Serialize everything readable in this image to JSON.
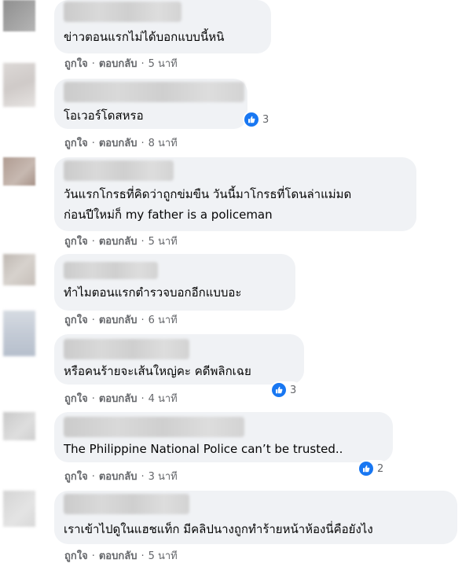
{
  "colors": {
    "bubble": "#f0f2f5",
    "text": "#050505",
    "meta": "#65676b",
    "like": "#1877f2"
  },
  "actions": {
    "like_label": "ถูกใจ",
    "reply_label": "ตอบกลับ",
    "separator": "·"
  },
  "comments": [
    {
      "lines": [
        "ข่าวตอนแรกไม่ได้บอกแบบนี้หนิ"
      ],
      "time": "5 นาที",
      "reaction_count": null
    },
    {
      "lines": [
        "โอเวอร์โดสหรอ"
      ],
      "time": "8 นาที",
      "reaction_icon": "like-icon",
      "reaction_count": "3"
    },
    {
      "lines": [
        "วันแรกโกรธที่คิดว่าถูกข่มขืน วันนี้มาโกรธที่โดนล่าแม่มด",
        "ก่อนปีใหม่ก็ my father is a policeman"
      ],
      "time": "5 นาที",
      "reaction_count": null
    },
    {
      "lines": [
        "ทำไมตอนแรกตำรวจบอกอีกแบบอะ"
      ],
      "time": "6 นาที",
      "reaction_count": null
    },
    {
      "lines": [
        "หรือคนร้ายจะเส้นใหญ่คะ คดีพลิกเฉย"
      ],
      "time": "4 นาที",
      "reaction_icon": "like-icon",
      "reaction_count": "3"
    },
    {
      "lines": [
        "The Philippine National Police can’t be trusted.."
      ],
      "time": "3 นาที",
      "reaction_icon": "like-icon",
      "reaction_count": "2"
    },
    {
      "lines": [
        "เราเข้าไปดูในแฮชแท็ก มีคลิปนางถูกทำร้ายหน้าห้องนี่คือยังไง"
      ],
      "time": "5 นาที",
      "reaction_count": null
    }
  ]
}
